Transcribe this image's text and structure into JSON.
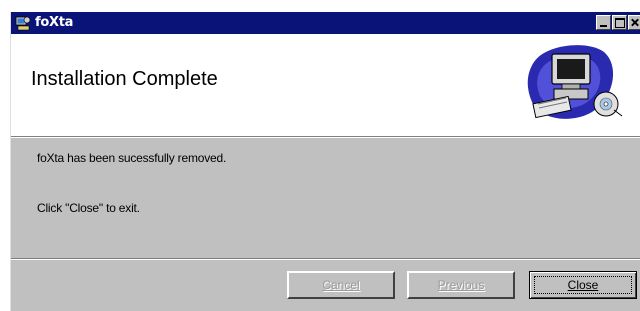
{
  "window": {
    "title": "foXta",
    "title_bar_color": "#0a1478",
    "controls": [
      "minimize-icon",
      "maximize-icon",
      "close-icon"
    ]
  },
  "banner": {
    "heading": "Installation Complete",
    "art_icon": "computer-with-disk-icon"
  },
  "body": {
    "message": "foXta has been sucessfully removed.",
    "instruction": "Click \"Close\" to exit."
  },
  "buttons": {
    "cancel": {
      "label": "Cancel",
      "enabled": false
    },
    "previous": {
      "label": "Previous",
      "enabled": false
    },
    "close": {
      "label": "Close",
      "enabled": true,
      "default": true
    }
  }
}
